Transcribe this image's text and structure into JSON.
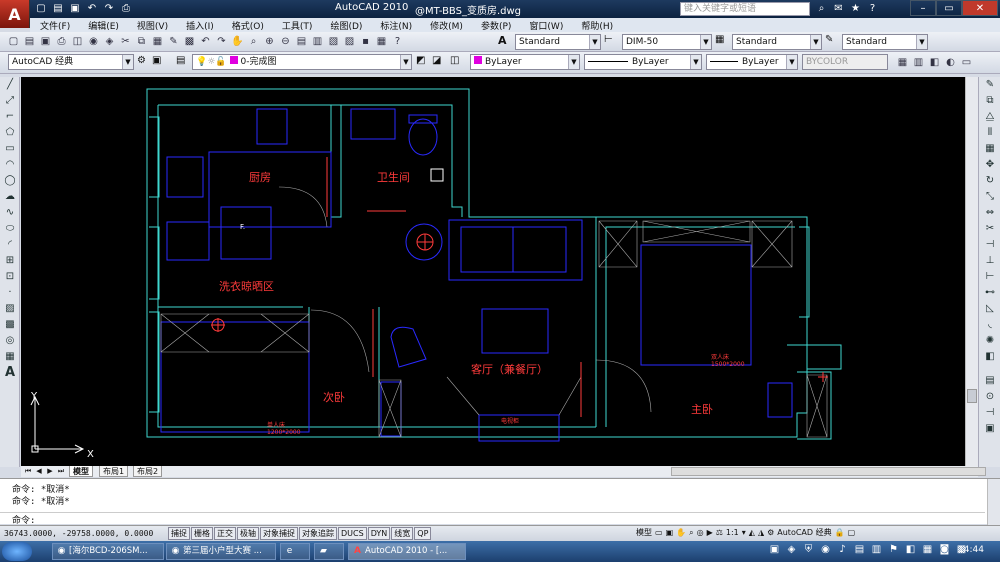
{
  "title": {
    "app": "AutoCAD 2010",
    "file": "@MT-BBS_变质房.dwg",
    "app_icon": "A",
    "search_placeholder": "键入关键字或短语"
  },
  "menu": [
    "文件(F)",
    "编辑(E)",
    "视图(V)",
    "插入(I)",
    "格式(O)",
    "工具(T)",
    "绘图(D)",
    "标注(N)",
    "修改(M)",
    "参数(P)",
    "窗口(W)",
    "帮助(H)"
  ],
  "toolbar2": {
    "text_style": "Standard",
    "dim_style": "DIM-50",
    "table_style": "Standard",
    "mleader_style": "Standard"
  },
  "toolbar3": {
    "workspace": "AutoCAD 经典",
    "layer": "0-完成图",
    "color": "ByLayer",
    "linetype": "ByLayer",
    "lineweight": "ByLayer",
    "plotstyle": "BYCOLOR"
  },
  "rooms": {
    "kitchen": "厨房",
    "bathroom": "卫生间",
    "laundry": "洗衣晾晒区",
    "second_bedroom": "次卧",
    "living": "客厅（兼餐厅）",
    "master": "主卧",
    "f_label": "F.",
    "bed2_label": "双人床",
    "bed2_size": "1500*2000",
    "bed1_label": "单人床",
    "bed1_size": "1200*2000",
    "tv_label": "电视柜",
    "ax_x": "X",
    "ax_y": "Y"
  },
  "tabs": {
    "model": "模型",
    "layout1": "布局1",
    "layout2": "布局2"
  },
  "command": {
    "line1": "命令: *取消*",
    "line2": "命令: *取消*",
    "prompt": "命令:"
  },
  "status": {
    "coords": "36743.0000, -29758.0000, 0.0000",
    "buttons": [
      "捕捉",
      "栅格",
      "正交",
      "极轴",
      "对象捕捉",
      "对象追踪",
      "DUCS",
      "DYN",
      "线宽",
      "QP"
    ],
    "model": "模型",
    "scale": "1:1",
    "workspace": "AutoCAD 经典"
  },
  "taskbar": {
    "items": [
      "[海尔BCD-206SM...",
      "第三届小户型大赛 ...",
      "",
      "",
      "AutoCAD 2010 - [..."
    ],
    "time": "14:44"
  },
  "colors": {
    "wall": "#3fd8d0",
    "furniture": "#2a2aff",
    "label": "#ff3b3b"
  }
}
